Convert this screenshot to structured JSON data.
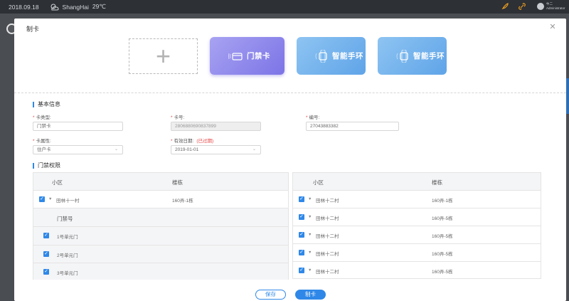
{
  "topbar": {
    "date": "2018.09.18",
    "city": "ShangHai",
    "temp": "29℃",
    "user_line1": "牛二",
    "user_line2": "Administrator"
  },
  "dialog": {
    "title": "制卡",
    "close_icon": "close-icon"
  },
  "cards": {
    "add_icon": "plus-icon",
    "access_card_label": "门禁卡",
    "band_label_1": "智能手环",
    "band_label_2": "智能手环"
  },
  "basic_info": {
    "section_title": "基本信息",
    "card_type_label": "卡类型:",
    "card_type_value": "门禁卡",
    "card_no_label": "卡号:",
    "card_no_value": "2806880690837899",
    "serial_label": "编号:",
    "serial_value": "27043883382",
    "card_attr_label": "卡属性:",
    "card_attr_value": "住户卡",
    "valid_date_label": "有效日期:",
    "valid_date_note": "(已过期)",
    "valid_date_value": "2019-01-01"
  },
  "access": {
    "section_title": "门禁权限",
    "left_table": {
      "col_community": "小区",
      "col_building": "楼栋",
      "rows": [
        {
          "community": "田林十一村",
          "building": "160弄-1栋",
          "checked": true
        }
      ],
      "sub_header": "门禁号",
      "doors": [
        "1号单元门",
        "2号单元门",
        "3号单元门"
      ]
    },
    "right_table": {
      "col_community": "小区",
      "col_building": "楼栋",
      "rows": [
        {
          "community": "田林十二村",
          "building": "160弄-1栋",
          "checked": true
        },
        {
          "community": "田林十二村",
          "building": "160弄-5栋",
          "checked": true
        },
        {
          "community": "田林十二村",
          "building": "160弄-5栋",
          "checked": true
        },
        {
          "community": "田林十二村",
          "building": "160弄-5栋",
          "checked": true
        },
        {
          "community": "田林十二村",
          "building": "160弄-5栋",
          "checked": true
        }
      ]
    }
  },
  "footer": {
    "save_label": "保存",
    "make_label": "制卡"
  },
  "colors": {
    "accent": "#2f88e8",
    "access_card": "#8c85ea",
    "band_card": "#6fb0ee",
    "required": "#e64545"
  }
}
